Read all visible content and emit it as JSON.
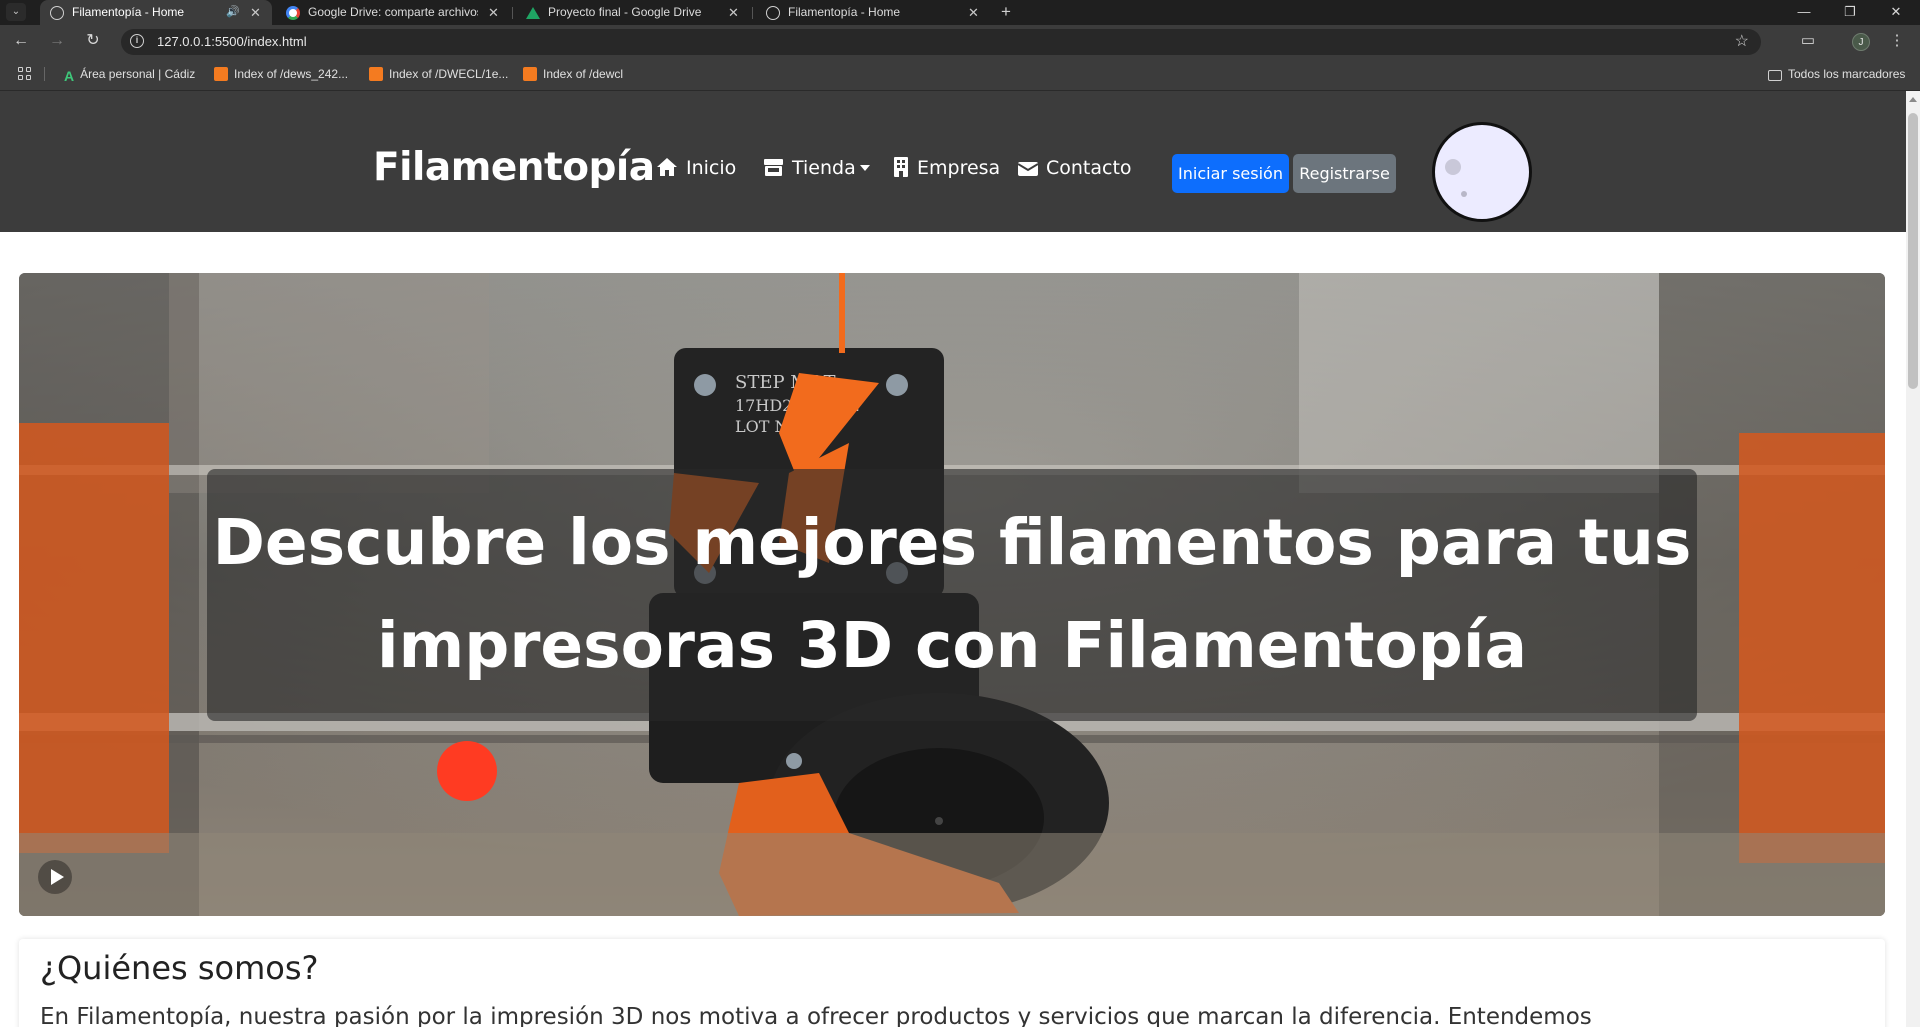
{
  "browser": {
    "tabs": [
      {
        "title": "Filamentopía - Home",
        "active": true,
        "has_sound": true
      },
      {
        "title": "Google Drive: comparte archivos",
        "active": false
      },
      {
        "title": "Proyecto final - Google Drive",
        "active": false
      },
      {
        "title": "Filamentopía - Home",
        "active": false
      }
    ],
    "url": "127.0.0.1:5500/index.html",
    "profile_initial": "J",
    "bookmarks": [
      {
        "label": "Área personal | Cádiz",
        "icon": "moodle-a-icon"
      },
      {
        "label": "Index of /dews_242...",
        "icon": "xampp-icon"
      },
      {
        "label": "Index of /DWECL/1e...",
        "icon": "xampp-icon"
      },
      {
        "label": "Index of /dewcl",
        "icon": "xampp-icon"
      }
    ],
    "all_bookmarks_label": "Todos los marcadores"
  },
  "site": {
    "brand": "Filamentopía",
    "nav": [
      {
        "label": "Inicio",
        "icon": "home-icon"
      },
      {
        "label": "Tienda",
        "icon": "store-icon",
        "dropdown": true
      },
      {
        "label": "Empresa",
        "icon": "building-icon"
      },
      {
        "label": "Contacto",
        "icon": "envelope-icon"
      }
    ],
    "login_label": "Iniciar sesión",
    "register_label": "Registrarse"
  },
  "hero": {
    "caption": "Descubre los mejores filamentos para tus impresoras 3D con Filamentopía",
    "printer_label_1": "STEP MOT",
    "printer_label_2": "17HD2201Z-22",
    "printer_label_3": "LOT NO.20   3"
  },
  "about": {
    "title": "¿Quiénes somos?",
    "text": "En Filamentopía, nuestra pasión por la impresión 3D nos motiva a ofrecer productos y servicios que marcan la diferencia. Entendemos"
  },
  "colors": {
    "navbar_bg": "#3c3c3c",
    "primary": "#0d6efd",
    "secondary": "#6c757d",
    "accent_orange": "#f26b1d"
  }
}
